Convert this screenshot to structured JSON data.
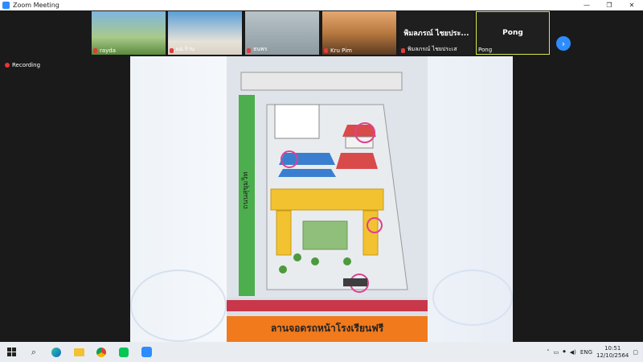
{
  "window": {
    "title": "Zoom Meeting"
  },
  "gallery": {
    "tiles": [
      {
        "name": "rayda"
      },
      {
        "name": "ผอ.ร้าน"
      },
      {
        "name": "ธนพร"
      },
      {
        "name": "Kru Pim"
      },
      {
        "name": "พิมลภรณ์ ไชยประ...",
        "subname": "พิมลภรณ์ ไชยประเส"
      },
      {
        "name": "Pong",
        "subname": "Pong"
      }
    ]
  },
  "recording": {
    "label": "Recording"
  },
  "share": {
    "parking_label": "ลานจอดรถหน้าโรงเรียนฟรี",
    "road_label": "ถนนสุขุมวิท"
  },
  "taskbar": {
    "language": "ENG",
    "time": "10:51",
    "date": "12/10/2564"
  }
}
